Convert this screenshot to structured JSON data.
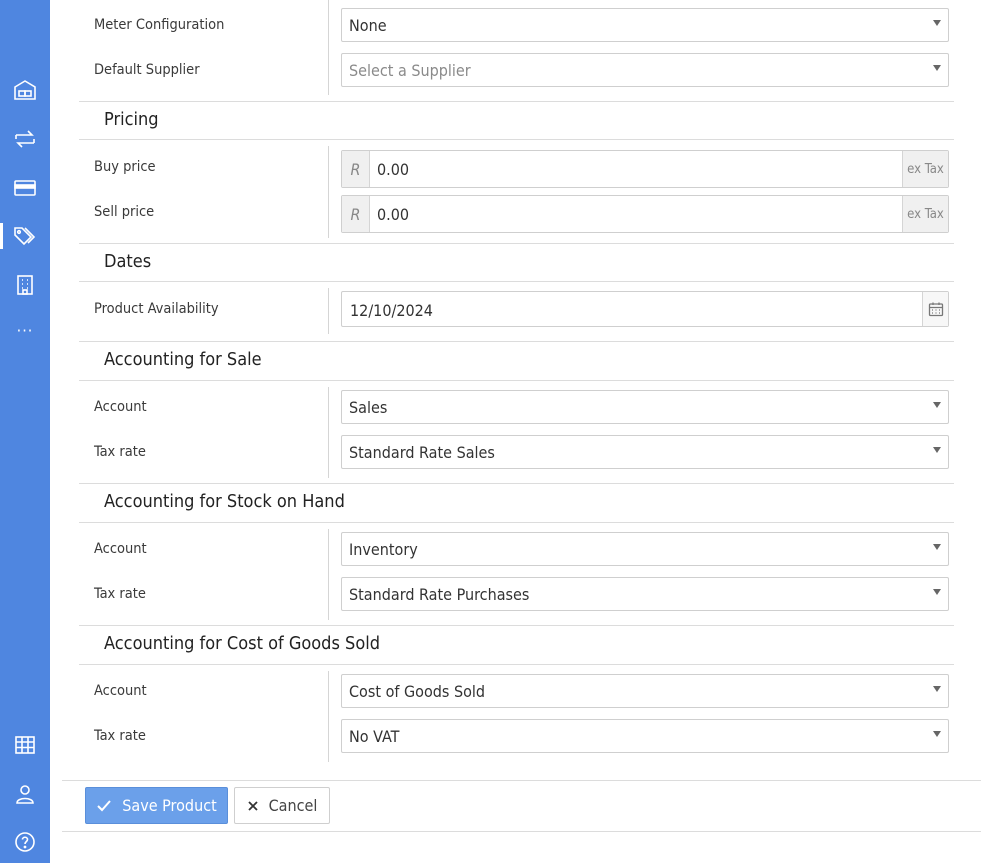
{
  "sidebar": {
    "icons": [
      "warehouse-icon",
      "transfer-icon",
      "card-icon",
      "tags-icon",
      "building-icon",
      "more-icon",
      "grid-icon",
      "user-icon",
      "help-icon"
    ],
    "more_label": "···"
  },
  "fields": {
    "meter": {
      "label": "Meter Configuration",
      "value": "None"
    },
    "supplier": {
      "label": "Default Supplier",
      "placeholder": "Select a Supplier"
    }
  },
  "pricing": {
    "title": "Pricing",
    "currency_symbol": "R",
    "tax_suffix": "ex Tax",
    "buy": {
      "label": "Buy price",
      "value": "0.00"
    },
    "sell": {
      "label": "Sell price",
      "value": "0.00"
    }
  },
  "dates": {
    "title": "Dates",
    "availability": {
      "label": "Product Availability",
      "value": "12/10/2024"
    }
  },
  "sale": {
    "title": "Accounting for Sale",
    "account": {
      "label": "Account",
      "value": "Sales"
    },
    "tax": {
      "label": "Tax rate",
      "value": "Standard Rate Sales"
    }
  },
  "stock": {
    "title": "Accounting for Stock on Hand",
    "account": {
      "label": "Account",
      "value": "Inventory"
    },
    "tax": {
      "label": "Tax rate",
      "value": "Standard Rate Purchases"
    }
  },
  "cogs": {
    "title": "Accounting for Cost of Goods Sold",
    "account": {
      "label": "Account",
      "value": "Cost of Goods Sold"
    },
    "tax": {
      "label": "Tax rate",
      "value": "No VAT"
    }
  },
  "actions": {
    "save_label": "Save Product",
    "cancel_label": "Cancel"
  },
  "colors": {
    "sidebar": "#4f86e0",
    "primary_button": "#6ba0ea"
  }
}
